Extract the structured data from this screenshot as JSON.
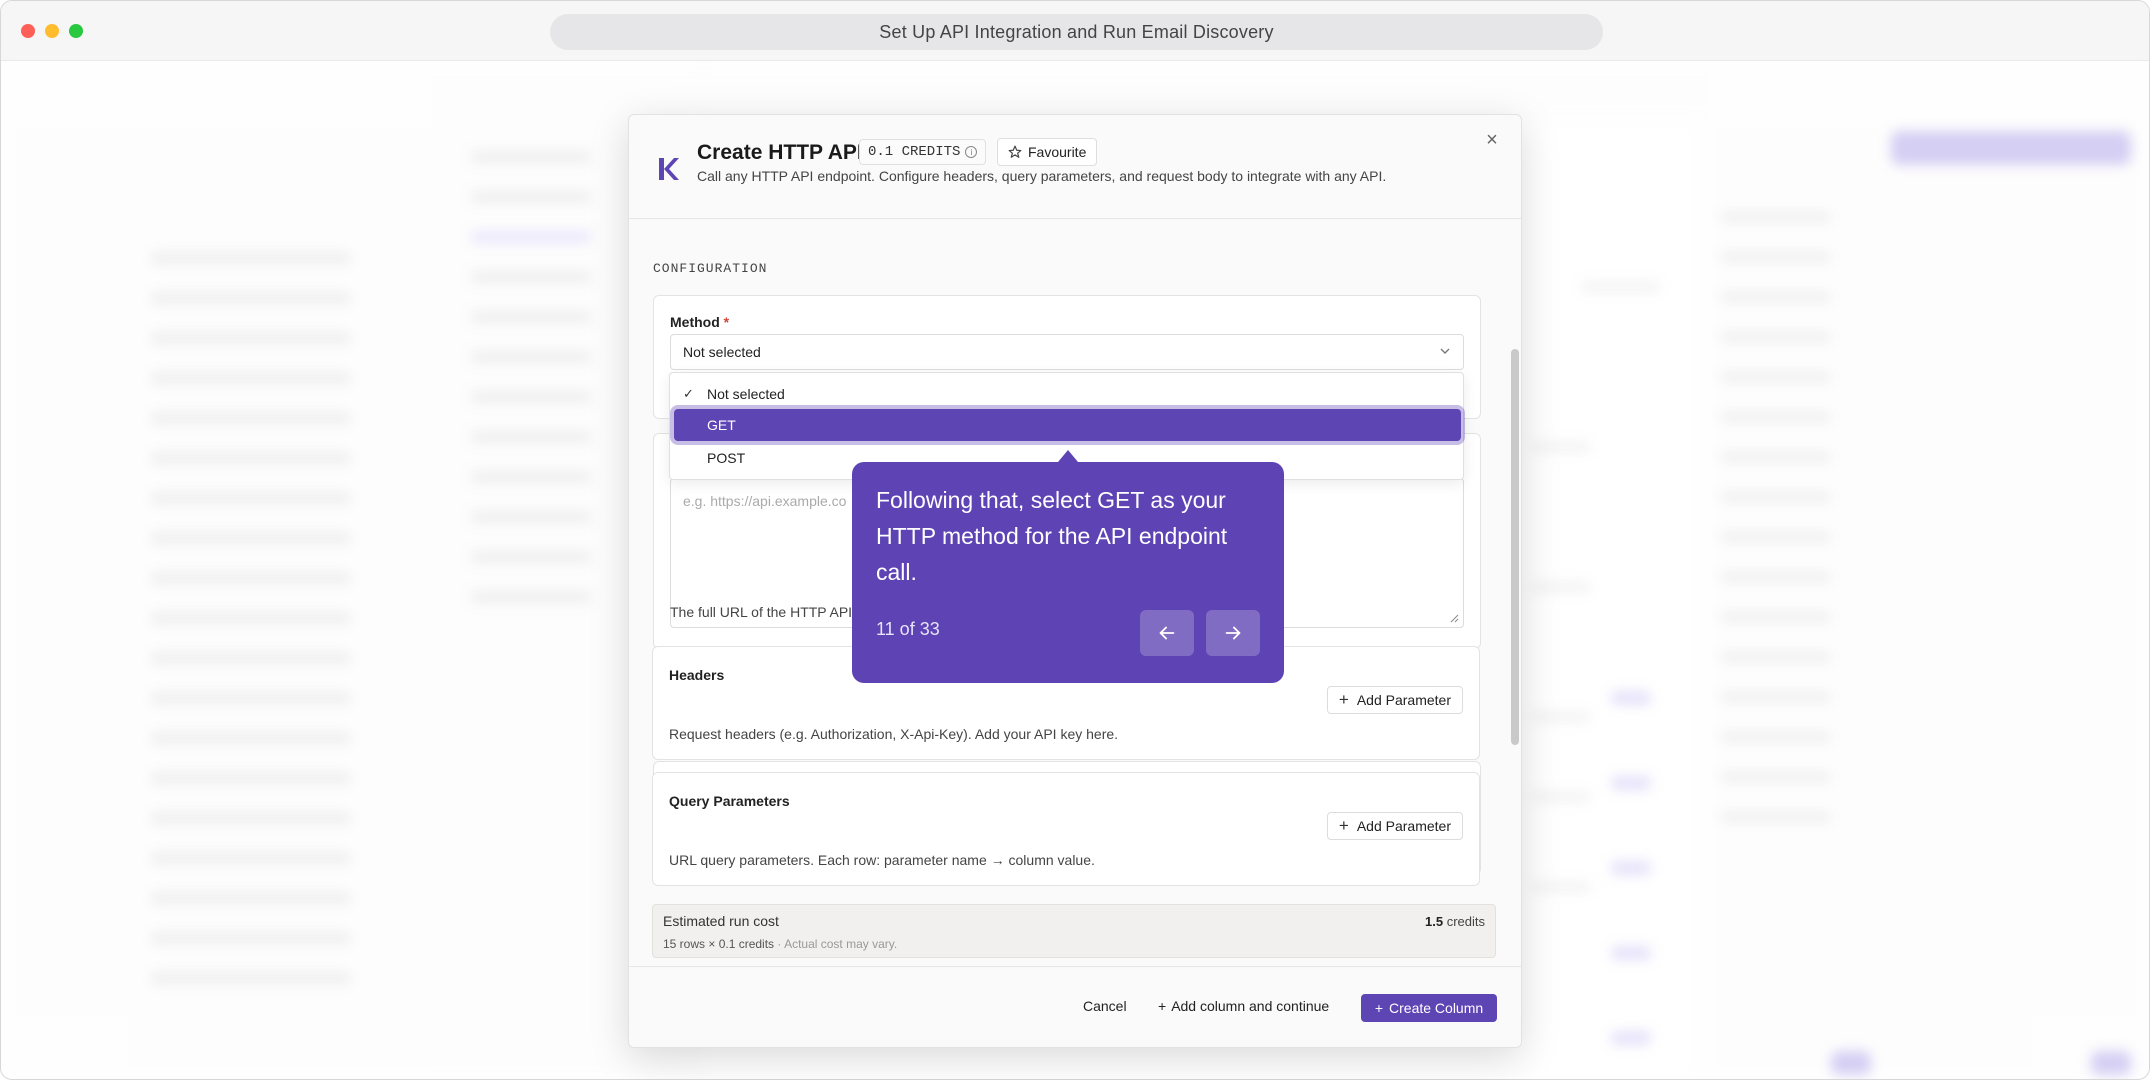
{
  "window": {
    "title": "Set Up API Integration and Run Email Discovery"
  },
  "modal": {
    "title": "Create HTTP API",
    "credits_badge": "0.1 CREDITS",
    "favourite_label": "Favourite",
    "subtitle": "Call any HTTP API endpoint. Configure headers, query parameters, and request body to integrate with any API.",
    "close_label": "×"
  },
  "config": {
    "section_label": "CONFIGURATION",
    "method": {
      "label": "Method",
      "required_mark": "*",
      "selected": "Not selected",
      "options": [
        "Not selected",
        "GET",
        "POST"
      ],
      "highlighted": "GET"
    },
    "url": {
      "placeholder": "e.g. https://api.example.co",
      "helper": "The full URL of the HTTP API"
    },
    "headers": {
      "label": "Headers",
      "add_label": "Add Parameter",
      "helper": "Request headers (e.g. Authorization, X-Api-Key). Add your API key here."
    },
    "query": {
      "label": "Query Parameters",
      "add_label": "Add Parameter",
      "helper": "URL query parameters. Each row: parameter name → column value."
    }
  },
  "cost": {
    "title": "Estimated run cost",
    "value": "1.5",
    "unit": "credits",
    "detail": "15 rows × 0.1 credits",
    "note": " · Actual cost may vary."
  },
  "footer": {
    "cancel_label": "Cancel",
    "add_continue_label": "Add column and continue",
    "create_label": "Create Column"
  },
  "tour": {
    "text": "Following that, select GET as your HTTP method for the API endpoint call.",
    "counter": "11 of 33",
    "prev_icon": "arrow-left-icon",
    "next_icon": "arrow-right-icon"
  },
  "colors": {
    "accent": "#5e45b4",
    "tooltip_bg": "#5d43b3"
  }
}
